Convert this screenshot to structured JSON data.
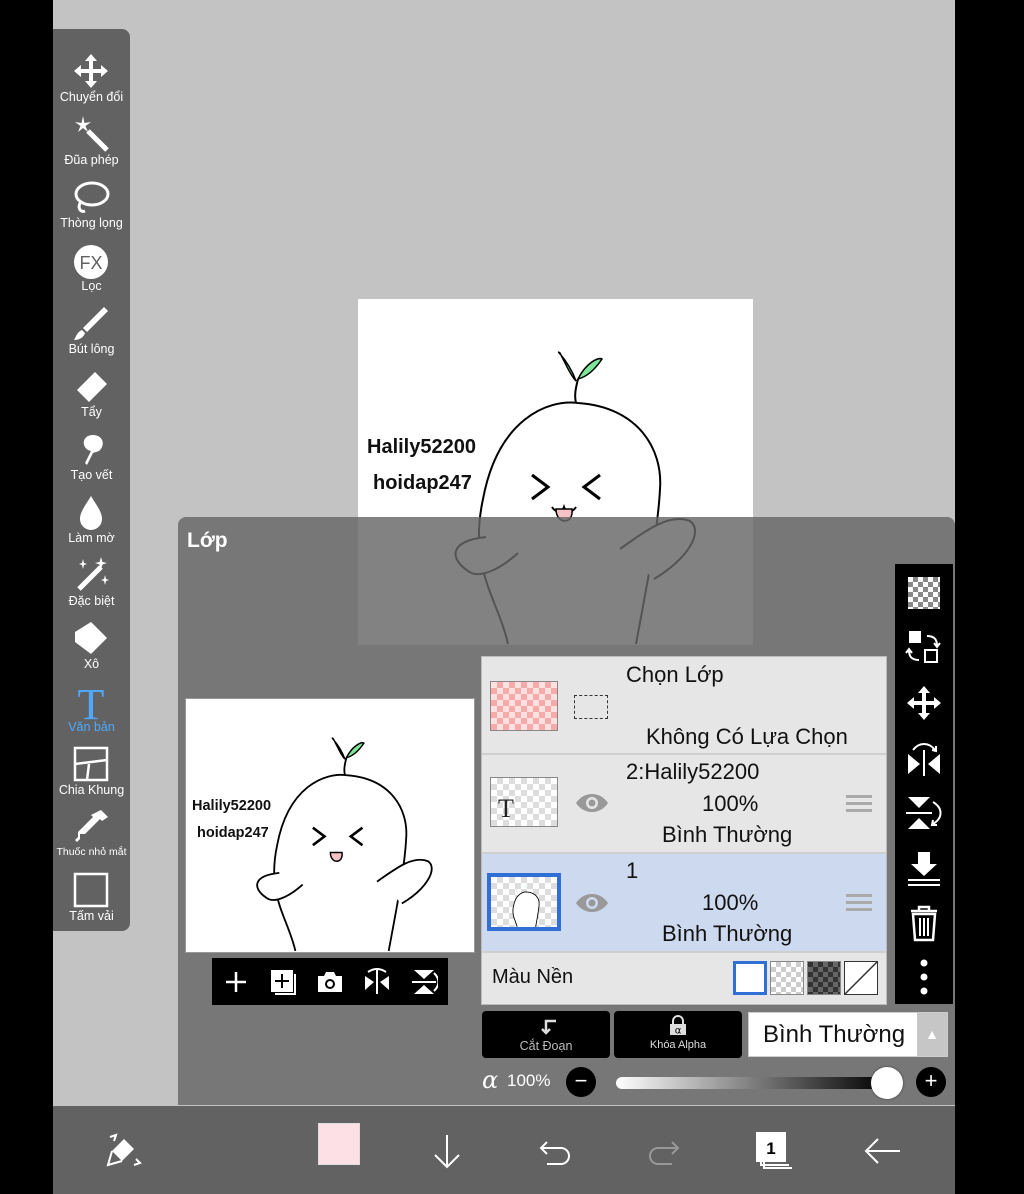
{
  "toolbar": {
    "tools": [
      {
        "name": "move-icon",
        "label": "Chuyển đổi"
      },
      {
        "name": "magic-wand-icon",
        "label": "Đũa phép"
      },
      {
        "name": "lasso-icon",
        "label": "Thòng lọng"
      },
      {
        "name": "fx-icon",
        "label": "Lọc"
      },
      {
        "name": "brush-icon",
        "label": "Bút lông"
      },
      {
        "name": "eraser-icon",
        "label": "Tẩy"
      },
      {
        "name": "smudge-icon",
        "label": "Tạo vết"
      },
      {
        "name": "blur-icon",
        "label": "Làm mờ"
      },
      {
        "name": "special-icon",
        "label": "Đặc biệt"
      },
      {
        "name": "bucket-icon",
        "label": "Xô"
      },
      {
        "name": "text-icon",
        "label": "Văn bản",
        "active": true
      },
      {
        "name": "frame-divider-icon",
        "label": "Chia Khung"
      },
      {
        "name": "eyedropper-icon",
        "label": "Thuốc nhỏ mắt"
      },
      {
        "name": "canvas-icon",
        "label": "Tấm vải"
      }
    ],
    "fx_glyph": "FX",
    "text_glyph": "T"
  },
  "canvas": {
    "text_line1": "Halily52200",
    "text_line2": "hoidap247"
  },
  "layer_panel": {
    "title": "Lớp",
    "preview_text_line1": "Halily52200",
    "preview_text_line2": "hoidap247",
    "selection_row": {
      "title": "Chọn Lớp",
      "subtitle": "Không Có Lựa Chọn"
    },
    "layers": [
      {
        "name": "2:Halily52200",
        "opacity": "100%",
        "blend": "Bình Thường",
        "thumb_glyph": "T",
        "selected": false
      },
      {
        "name": "1",
        "opacity": "100%",
        "blend": "Bình Thường",
        "selected": true
      }
    ],
    "background_label": "Màu Nền",
    "clip_label": "Cắt Đoạn",
    "alpha_lock_label": "Khóa Alpha",
    "blend_mode": "Bình Thường",
    "alpha_symbol": "α",
    "alpha_value": "100%",
    "alpha_fraction": 1.0
  },
  "bottom_bar": {
    "current_color": "#fde0e6",
    "layer_count": "1"
  },
  "colors": {
    "accent": "#2f6fd6",
    "active_tool": "#4fa8ff",
    "leaf": "#7ee69b"
  }
}
